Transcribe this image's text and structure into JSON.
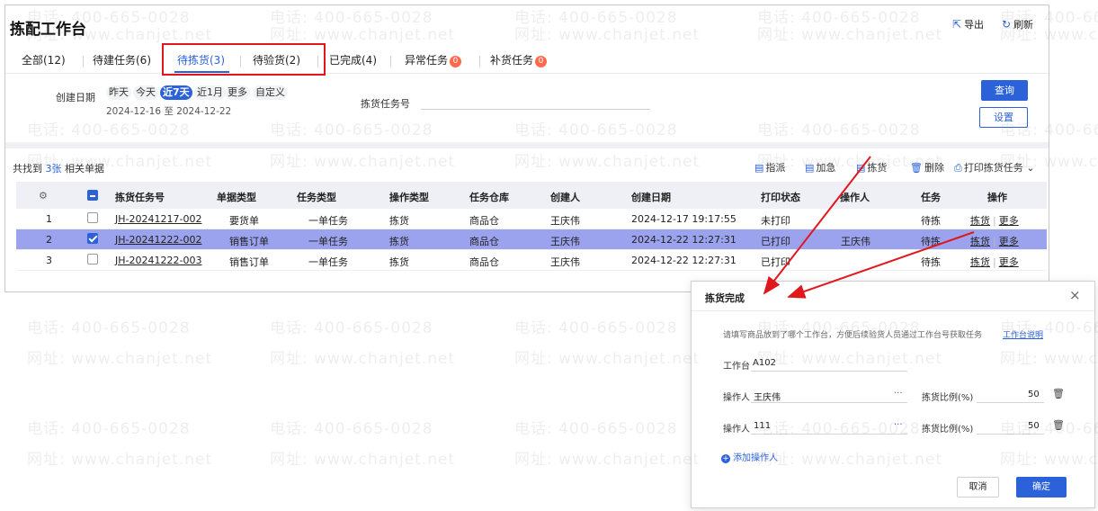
{
  "app": {
    "title": "拣配工作台",
    "export_label": "导出",
    "refresh_label": "刷新"
  },
  "tabs": [
    {
      "label": "全部(12)"
    },
    {
      "label": "待建任务(6)"
    },
    {
      "label": "待拣货(3)"
    },
    {
      "label": "待验货(2)"
    },
    {
      "label": "已完成(4)"
    },
    {
      "label": "异常任务",
      "badge": "0"
    },
    {
      "label": "补货任务",
      "badge": "0"
    }
  ],
  "filter": {
    "date_label": "创建日期",
    "chips": [
      "昨天",
      "今天",
      "近7天",
      "近1月",
      "更多",
      "自定义"
    ],
    "selected_chip": "近7天",
    "date_range": "2024-12-16 至 2024-12-22",
    "task_no_label": "拣货任务号",
    "task_no_value": "",
    "search_label": "查询",
    "settings_label": "设置"
  },
  "listbar": {
    "found_prefix": "共找到",
    "found_count": "3张",
    "found_suffix": "相关单据",
    "actions": [
      "指派",
      "加急",
      "拣货",
      "删除",
      "打印拣货任务"
    ]
  },
  "table": {
    "headers": [
      "拣货任务号",
      "单据类型",
      "任务类型",
      "操作类型",
      "任务仓库",
      "创建人",
      "创建日期",
      "打印状态",
      "操作人",
      "任务",
      "操作"
    ],
    "rows": [
      {
        "idx": "1",
        "checked": false,
        "task_no": "JH-20241217-002",
        "doc_type": "要货单",
        "task_type": "一单任务",
        "op_type": "拣货",
        "warehouse": "商品仓",
        "creator": "王庆伟",
        "created": "2024-12-17 19:17:55",
        "print_status": "未打印",
        "operator": "",
        "task_state": "待拣",
        "op1": "拣货",
        "op2": "更多"
      },
      {
        "idx": "2",
        "checked": true,
        "task_no": "JH-20241222-002",
        "doc_type": "销售订单",
        "task_type": "一单任务",
        "op_type": "拣货",
        "warehouse": "商品仓",
        "creator": "王庆伟",
        "created": "2024-12-22 12:27:31",
        "print_status": "已打印",
        "operator": "王庆伟",
        "task_state": "待拣",
        "op1": "拣货",
        "op2": "更多"
      },
      {
        "idx": "3",
        "checked": false,
        "task_no": "JH-20241222-003",
        "doc_type": "销售订单",
        "task_type": "一单任务",
        "op_type": "拣货",
        "warehouse": "商品仓",
        "creator": "王庆伟",
        "created": "2024-12-22 12:27:31",
        "print_status": "已打印",
        "operator": "",
        "task_state": "待拣",
        "op1": "拣货",
        "op2": "更多"
      }
    ]
  },
  "dialog": {
    "title": "拣货完成",
    "description": "请填写商品放到了哪个工作台，方便后续验货人员通过工作台号获取任务",
    "help_link": "工作台说明",
    "workbench_label": "工作台",
    "workbench_value": "A102",
    "operators": [
      {
        "label": "操作人",
        "value": "王庆伟",
        "ratio_label": "拣货比例(%)",
        "ratio": "50"
      },
      {
        "label": "操作人",
        "value": "111",
        "ratio_label": "拣货比例(%)",
        "ratio": "50"
      }
    ],
    "more_dots": "···",
    "add_operator": "添加操作人",
    "cancel_label": "取消",
    "confirm_label": "确定"
  },
  "watermark": {
    "phone": "电话: 400-665-0028",
    "site": "网址: www.chanjet.net"
  },
  "colors": {
    "accent": "#2b62d9",
    "annotation": "#e0181d",
    "selected_row": "#9ca3ee",
    "badge": "#ff6a4d"
  }
}
